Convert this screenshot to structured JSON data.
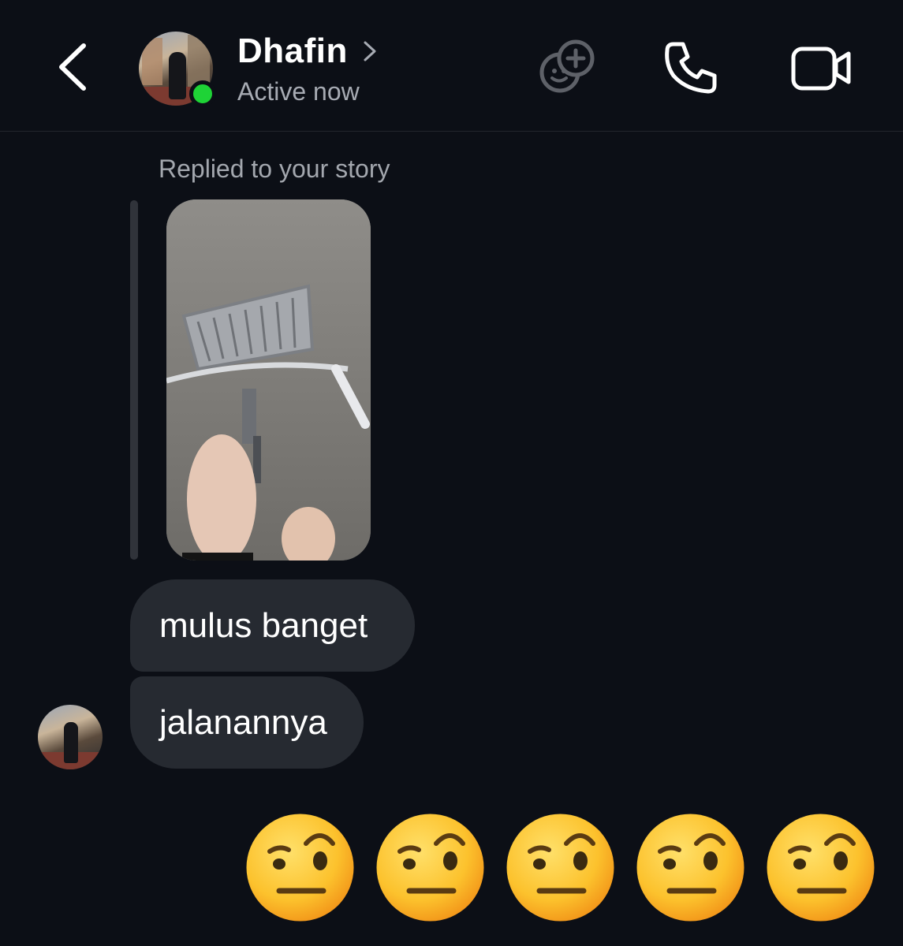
{
  "header": {
    "contact_name": "Dhafin",
    "status": "Active now",
    "icons": [
      "back-chevron-icon",
      "name-chevron-icon",
      "games-icon",
      "phone-icon",
      "video-camera-icon"
    ],
    "online_color": "#1ed336"
  },
  "conversation": {
    "reply_label": "Replied to your story",
    "messages": [
      {
        "text": "mulus banget"
      },
      {
        "text": "jalanannya"
      }
    ],
    "emoji_reply": [
      "🤨",
      "🤨",
      "🤨",
      "🤨",
      "🤨"
    ]
  },
  "colors": {
    "background": "#0c0f16",
    "bubble": "#262a31",
    "secondary_text": "#a7abb3"
  }
}
